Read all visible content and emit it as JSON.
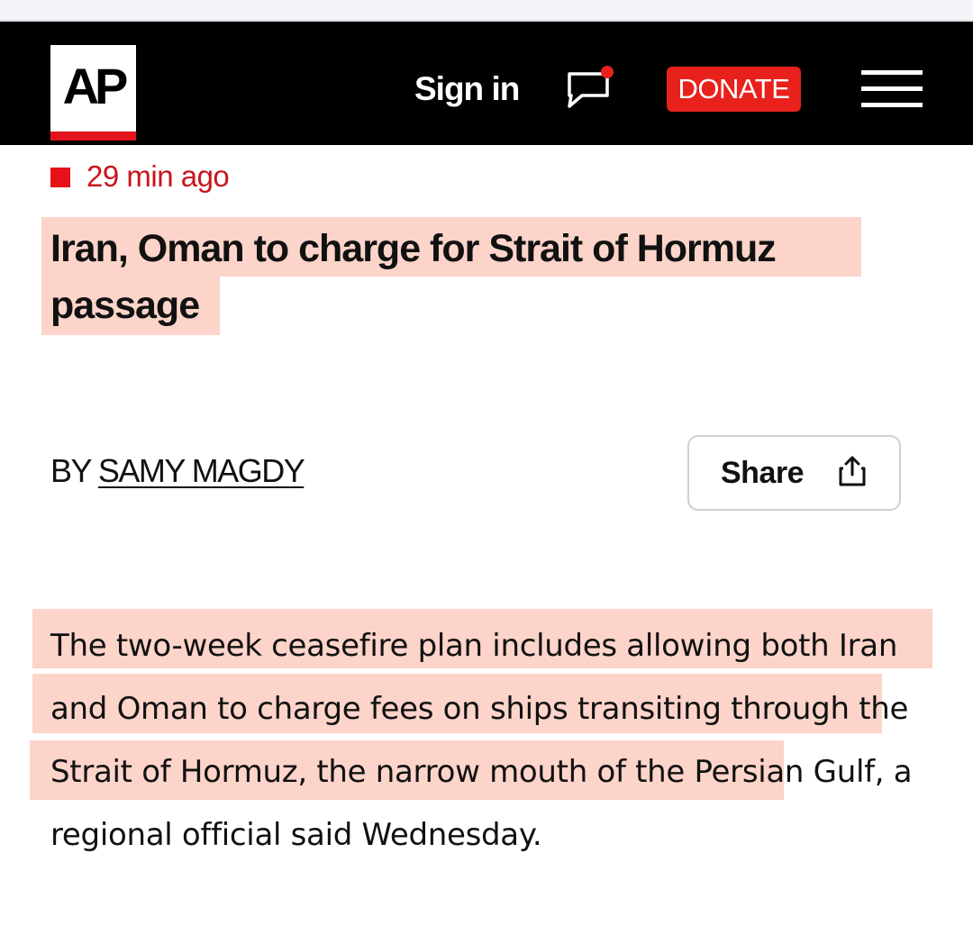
{
  "header": {
    "logo_text": "AP",
    "sign_in_label": "Sign in",
    "donate_label": "DONATE",
    "icons": [
      "chat-notification-icon",
      "hamburger-menu-icon"
    ],
    "colors": {
      "header_bg": "#000000",
      "accent_red": "#e8211c",
      "highlight": "#fdd4c9"
    }
  },
  "article": {
    "timestamp": "29 min ago",
    "headline": "Iran, Oman to charge for Strait of Hormuz passage",
    "byline_prefix": "BY",
    "author": "SAMY MAGDY",
    "share_label": "Share",
    "body": "The two-week ceasefire plan includes allowing both Iran and Oman to charge fees on ships transiting through the Strait of Hormuz, the narrow mouth of the Persian Gulf, a regional official said Wednesday."
  }
}
